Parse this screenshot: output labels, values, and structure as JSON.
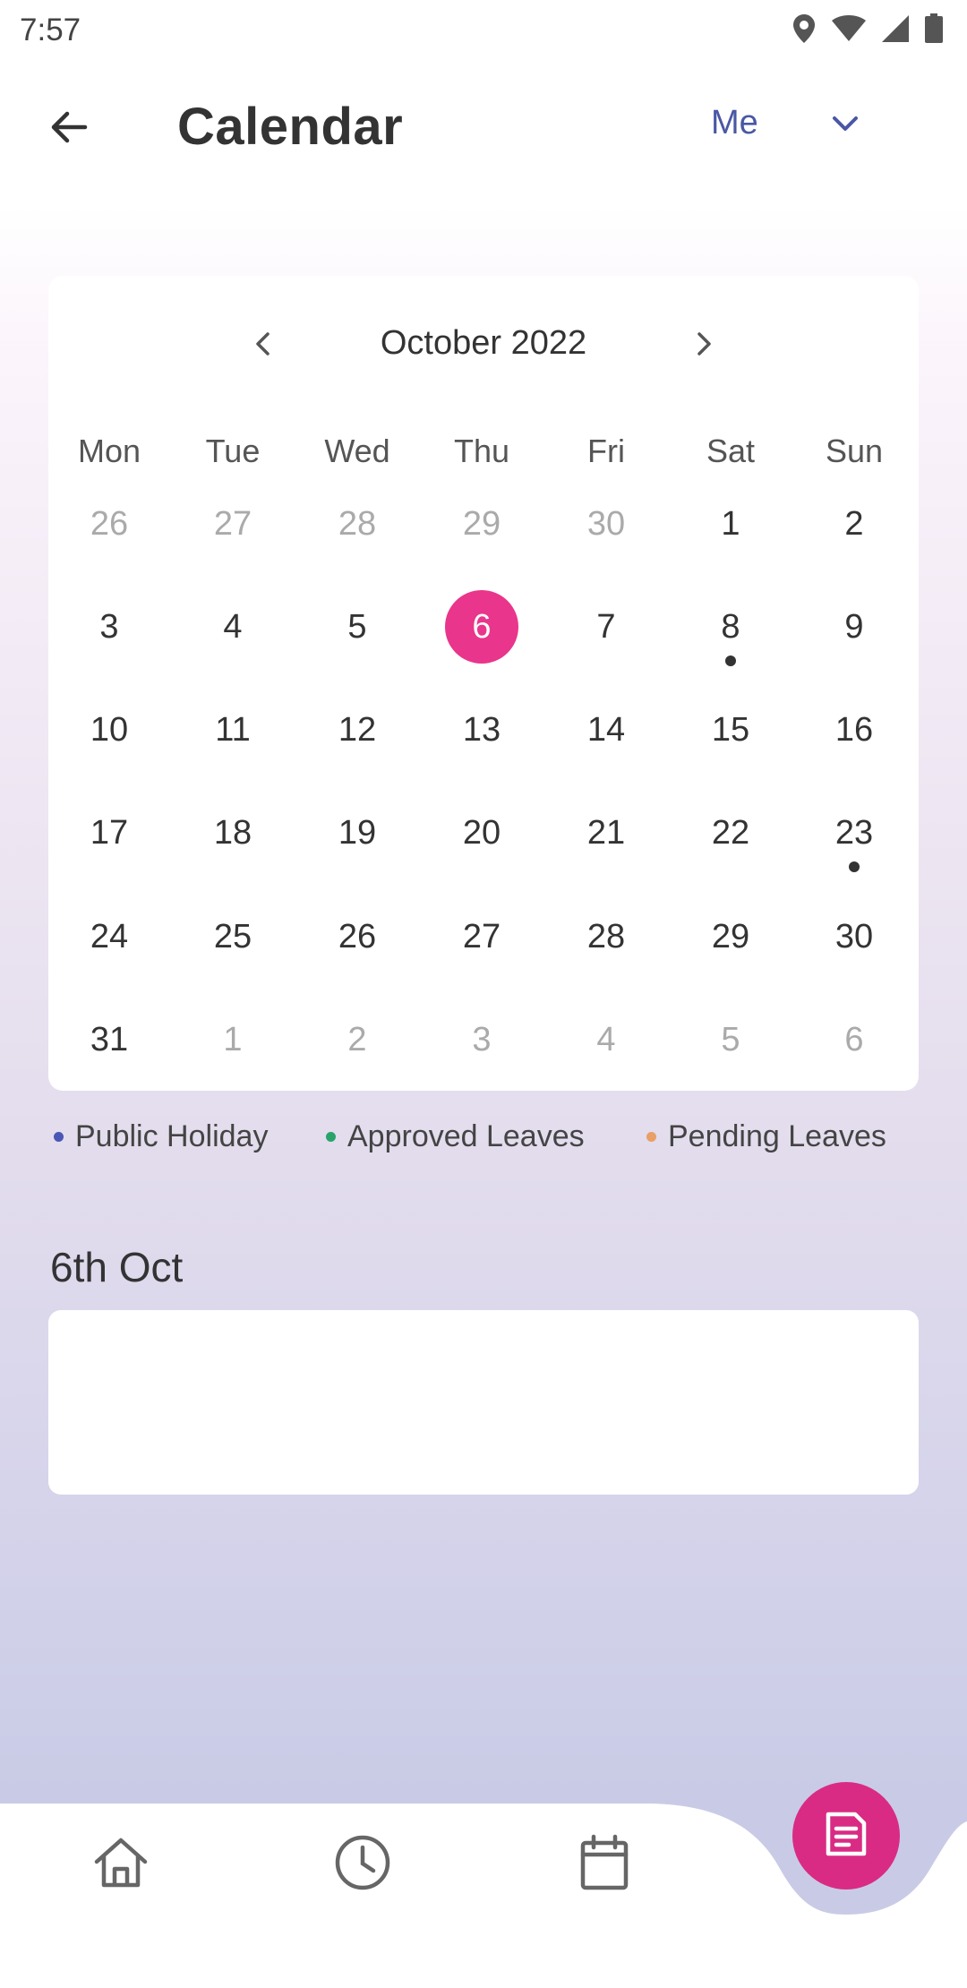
{
  "status_bar": {
    "time": "7:57",
    "icons": [
      "location-icon",
      "wifi-icon",
      "signal-icon",
      "battery-icon"
    ]
  },
  "header": {
    "back_icon": "arrow-left-icon",
    "title": "Calendar",
    "user_selector": {
      "value": "Me",
      "icon": "chevron-down-icon"
    }
  },
  "calendar": {
    "month_label": "October 2022",
    "prev_icon": "chevron-left-icon",
    "next_icon": "chevron-right-icon",
    "weekdays": [
      "Mon",
      "Tue",
      "Wed",
      "Thu",
      "Fri",
      "Sat",
      "Sun"
    ],
    "weeks": [
      [
        {
          "d": "26",
          "m": true
        },
        {
          "d": "27",
          "m": true
        },
        {
          "d": "28",
          "m": true
        },
        {
          "d": "29",
          "m": true
        },
        {
          "d": "30",
          "m": true
        },
        {
          "d": "1"
        },
        {
          "d": "2"
        }
      ],
      [
        {
          "d": "3"
        },
        {
          "d": "4"
        },
        {
          "d": "5"
        },
        {
          "d": "6",
          "selected": true
        },
        {
          "d": "7"
        },
        {
          "d": "8",
          "dot": true
        },
        {
          "d": "9"
        }
      ],
      [
        {
          "d": "10"
        },
        {
          "d": "11"
        },
        {
          "d": "12"
        },
        {
          "d": "13"
        },
        {
          "d": "14"
        },
        {
          "d": "15"
        },
        {
          "d": "16"
        }
      ],
      [
        {
          "d": "17"
        },
        {
          "d": "18"
        },
        {
          "d": "19"
        },
        {
          "d": "20"
        },
        {
          "d": "21"
        },
        {
          "d": "22"
        },
        {
          "d": "23",
          "dot": true
        }
      ],
      [
        {
          "d": "24"
        },
        {
          "d": "25"
        },
        {
          "d": "26"
        },
        {
          "d": "27"
        },
        {
          "d": "28"
        },
        {
          "d": "29"
        },
        {
          "d": "30"
        }
      ],
      [
        {
          "d": "31"
        },
        {
          "d": "1",
          "m": true
        },
        {
          "d": "2",
          "m": true
        },
        {
          "d": "3",
          "m": true
        },
        {
          "d": "4",
          "m": true
        },
        {
          "d": "5",
          "m": true
        },
        {
          "d": "6",
          "m": true
        }
      ]
    ],
    "colors": {
      "selected": "#e9358b",
      "dot": "#333333",
      "muted_text": "#aaaaaa"
    }
  },
  "legend": [
    {
      "label": "Public Holiday",
      "color": "#4a57b5"
    },
    {
      "label": "Approved Leaves",
      "color": "#2aa36b"
    },
    {
      "label": "Pending Leaves",
      "color": "#e8a065"
    }
  ],
  "selected_day": {
    "label": "6th Oct"
  },
  "bottom_nav": {
    "items": [
      {
        "name": "home",
        "icon": "home-icon"
      },
      {
        "name": "history",
        "icon": "clock-icon"
      },
      {
        "name": "calendar",
        "icon": "calendar-icon"
      }
    ],
    "fab_icon": "document-icon",
    "fab_color": "#d92b84"
  }
}
